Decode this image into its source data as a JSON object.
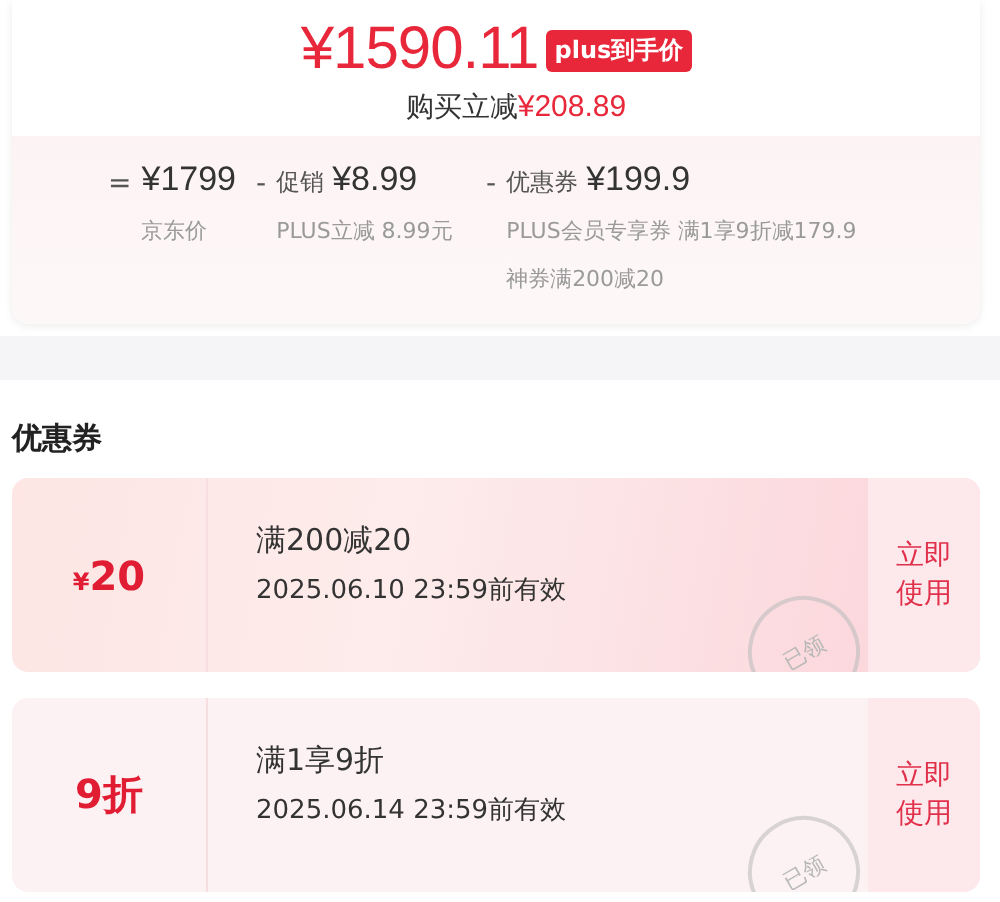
{
  "price": {
    "amount": "¥1590.11",
    "badge": "plus到手价",
    "saving_label": "购买立减",
    "saving": "¥208.89"
  },
  "breakdown": [
    {
      "op": "=",
      "amount": "¥1799",
      "notes": [
        "京东价"
      ]
    },
    {
      "op": "-",
      "label": "促销",
      "amount": "¥8.99",
      "notes": [
        "PLUS立减 8.99元"
      ]
    },
    {
      "op": "-",
      "label": "优惠券",
      "amount": "¥199.9",
      "notes": [
        "PLUS会员专享券 满1享9折减179.9",
        "神券满200减20"
      ]
    }
  ],
  "coupons_title": "优惠券",
  "coupons": [
    {
      "symbol": "¥",
      "value": "20",
      "condition": "满200减20",
      "validity": "2025.06.10 23:59前有效",
      "stamp": "已领",
      "action": "立即使用"
    },
    {
      "value": "9折",
      "condition": "满1享9折",
      "validity": "2025.06.14 23:59前有效",
      "stamp": "已领",
      "action": "立即使用"
    }
  ]
}
